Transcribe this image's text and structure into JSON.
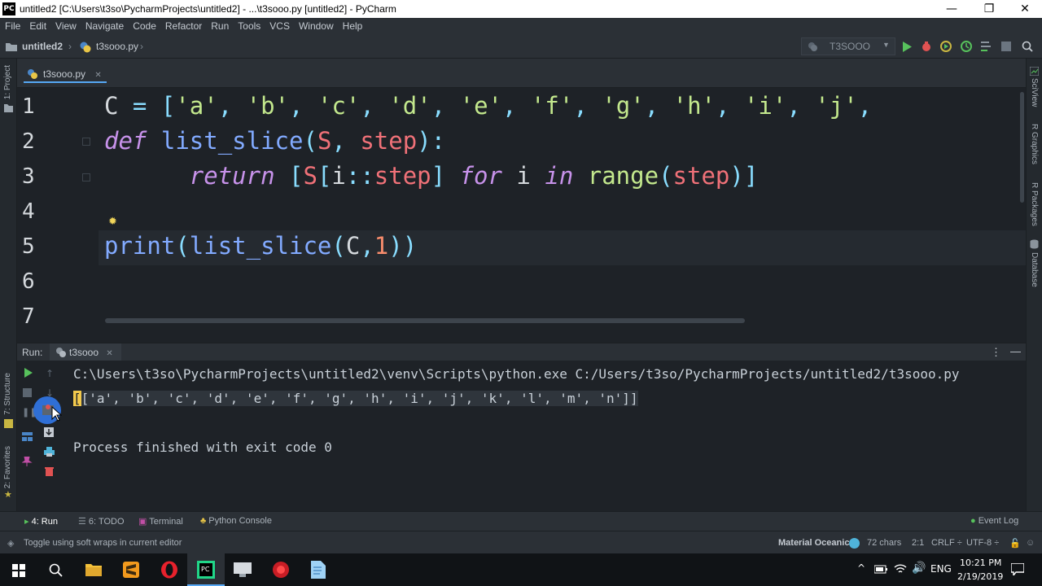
{
  "window": {
    "logo_text": "PC",
    "title": "untitled2 [C:\\Users\\t3so\\PycharmProjects\\untitled2] - ...\\t3sooo.py [untitled2] - PyCharm",
    "minimize": "—",
    "maximize": "❐",
    "close": "✕"
  },
  "menu": [
    {
      "label": "File"
    },
    {
      "label": "Edit"
    },
    {
      "label": "View"
    },
    {
      "label": "Navigate"
    },
    {
      "label": "Code"
    },
    {
      "label": "Refactor"
    },
    {
      "label": "Run"
    },
    {
      "label": "Tools"
    },
    {
      "label": "VCS"
    },
    {
      "label": "Window"
    },
    {
      "label": "Help"
    }
  ],
  "navbar": {
    "project": "untitled2",
    "file": "t3sooo.py",
    "run_config": "T3SOOO",
    "accent_run": "#57c15c",
    "accent_debug": "#e05252"
  },
  "left_strip": {
    "project": "1: Project",
    "structure": "7: Structure",
    "favorites": "2: Favorites"
  },
  "right_strip": {
    "sciview": "SciView",
    "r_graphics": "R Graphics",
    "r_packages": "R Packages",
    "database": "Database"
  },
  "editor": {
    "tab_label": "t3sooo.py",
    "tab_close": "✕",
    "line_numbers": [
      "1",
      "2",
      "3",
      "4",
      "5",
      "6",
      "7"
    ]
  },
  "run_panel": {
    "label": "Run:",
    "tab_label": "t3sooo",
    "tab_close": "✕",
    "menu": "⋮",
    "minimize": "—",
    "command": "C:\\Users\\t3so\\PycharmProjects\\untitled2\\venv\\Scripts\\python.exe C:/Users/t3so/PycharmProjects/untitled2/t3sooo.py",
    "output_cursor": "[",
    "output_rest": "['a', 'b', 'c', 'd', 'e', 'f', 'g', 'h', 'i', 'j', 'k', 'l', 'm', 'n']]",
    "exit_message": "Process finished with exit code 0"
  },
  "bottom_tabs": {
    "run": "4: Run",
    "todo": "6: TODO",
    "terminal": "Terminal",
    "python_console": "Python Console",
    "event_log": "Event Log"
  },
  "status": {
    "message": "Toggle using soft wraps in current editor",
    "theme": "Material Oceanic",
    "chars": "72 chars",
    "position": "2:1",
    "line_sep": "CRLF ÷",
    "encoding": "UTF-8 ÷"
  },
  "taskbar": {
    "lang": "ENG",
    "time": "10:21 PM",
    "date": "2/19/2019"
  }
}
